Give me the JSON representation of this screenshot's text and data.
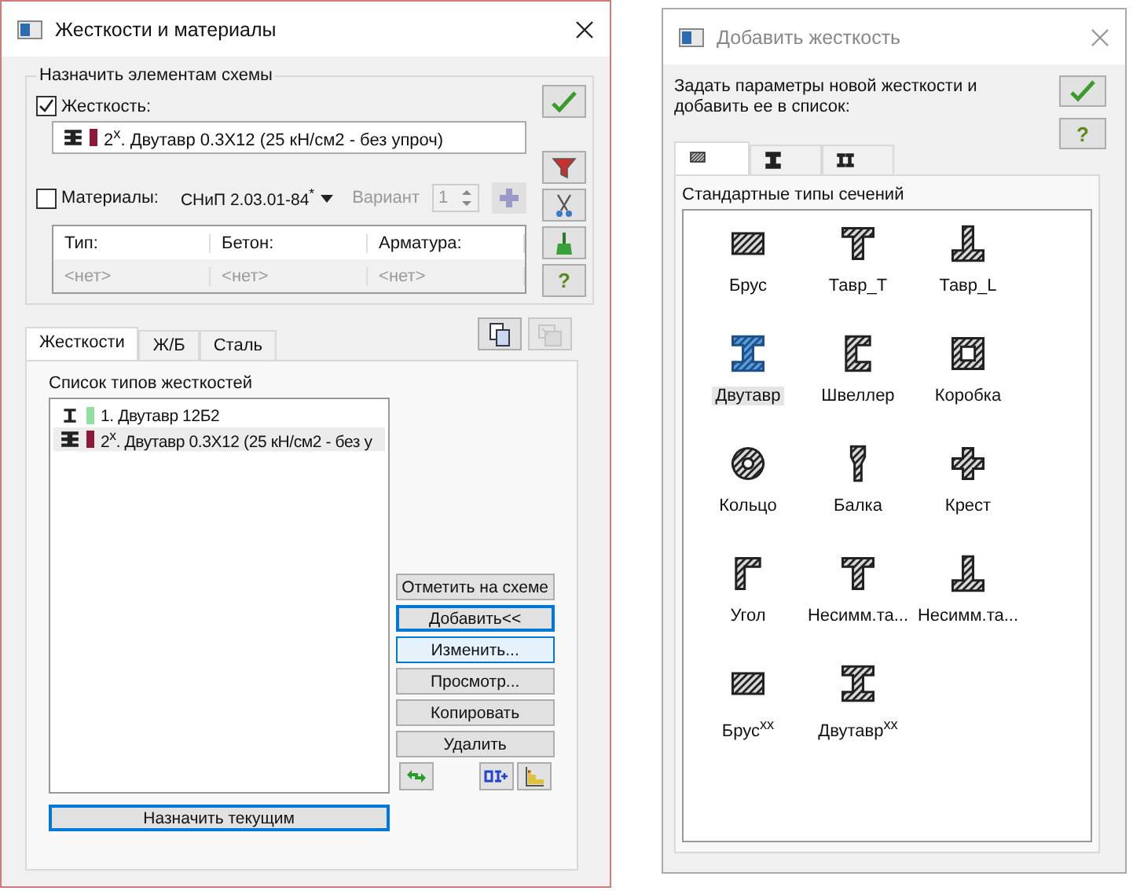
{
  "left_dialog": {
    "title": "Жесткости и материалы",
    "active": true,
    "assign_group": {
      "title": "Назначить элементам схемы",
      "stiffness": {
        "label": "Жесткость:",
        "checked": true,
        "value": "2$^{x}$. Двутавр 0.3X12 (25 кН/см2 - без упроч)",
        "kind": "composite",
        "color": "#8b1a3a"
      },
      "materials": {
        "label": "Материалы:",
        "checked": false,
        "norm": "СНиП 2.03.01-84$^{*}$",
        "variant_label": "Вариант",
        "variant_value": "1"
      },
      "table": {
        "columns": [
          "Тип:",
          "Бетон:",
          "Арматура:"
        ],
        "row": [
          "<нет>",
          "<нет>",
          "<нет>"
        ]
      }
    },
    "help_button": "?",
    "icon_buttons": [
      {
        "kind": "copy",
        "disabled": false
      },
      {
        "kind": "paste",
        "disabled": true
      }
    ],
    "tabs": [
      {
        "label": "Жесткости",
        "selected": true
      },
      {
        "label": "Ж/Б",
        "selected": false
      },
      {
        "label": "Сталь",
        "selected": false
      }
    ],
    "list_title": "Список типов жесткостей",
    "stiffness_list": [
      {
        "text": "1. Двутавр 12Б2",
        "kind": "ibeam_plain",
        "color": "#90e0a0",
        "selected": false
      },
      {
        "text": "2$^{x}$. Двутавр 0.3X12 (25 кН/см2 - без у",
        "kind": "composite",
        "color": "#8b1a3a",
        "selected": true
      }
    ],
    "buttons": [
      {
        "label": "Отметить на схеме",
        "kind": "normal"
      },
      {
        "label": "Добавить<<",
        "kind": "focused"
      },
      {
        "label": "Изменить...",
        "kind": "hover"
      },
      {
        "label": "Просмотр...",
        "kind": "normal"
      },
      {
        "label": "Копировать",
        "kind": "normal"
      },
      {
        "label": "Удалить",
        "kind": "normal"
      }
    ],
    "assign_button": {
      "label": "Назначить текущим",
      "kind": "focused"
    }
  },
  "right_dialog": {
    "title": "Добавить жесткость",
    "active": false,
    "prompt": "Задать параметры новой жесткости и добавить ее в список:",
    "help_button": "?",
    "tabs": [
      {
        "kind": "bar",
        "selected": true
      },
      {
        "kind": "ibeam",
        "selected": false
      },
      {
        "kind": "double",
        "selected": false
      }
    ],
    "group_title": "Стандартные типы сечений",
    "sections": [
      {
        "label": "Брус",
        "kind": "bar",
        "selected": false
      },
      {
        "label": "Тавр_Т",
        "kind": "tee_t",
        "selected": false
      },
      {
        "label": "Тавр_L",
        "kind": "tee_l",
        "selected": false
      },
      {
        "label": "Двутавр",
        "kind": "ibeam",
        "selected": true
      },
      {
        "label": "Швеллер",
        "kind": "channel",
        "selected": false
      },
      {
        "label": "Коробка",
        "kind": "box",
        "selected": false
      },
      {
        "label": "Кольцо",
        "kind": "ring",
        "selected": false
      },
      {
        "label": "Балка",
        "kind": "beam",
        "selected": false
      },
      {
        "label": "Крест",
        "kind": "cross",
        "selected": false
      },
      {
        "label": "Угол",
        "kind": "angle",
        "selected": false
      },
      {
        "label": "Несимм.та...",
        "kind": "tee_t",
        "selected": false
      },
      {
        "label": "Несимм.та...",
        "kind": "tee_l",
        "selected": false
      },
      {
        "label": "Брус$^{xx}$",
        "kind": "bar",
        "selected": false
      },
      {
        "label": "Двутавр$^{xx}$",
        "kind": "ibeam",
        "selected": false
      }
    ]
  }
}
